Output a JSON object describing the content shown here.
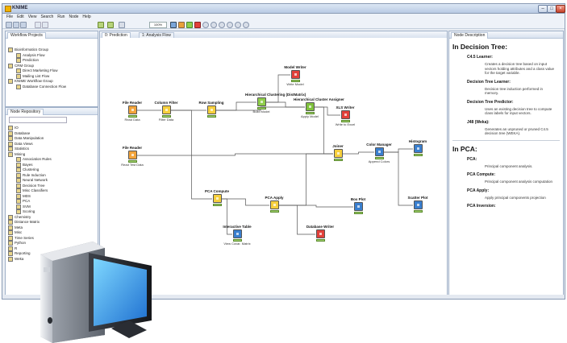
{
  "window": {
    "title": "KNIME"
  },
  "menu": [
    "File",
    "Edit",
    "View",
    "Search",
    "Run",
    "Node",
    "Help"
  ],
  "toolbar": {
    "zoom": "100%"
  },
  "projects": {
    "tab": "Workflow Projects",
    "items": [
      {
        "label": "Bioinformatics Group",
        "level": 0
      },
      {
        "label": "Analysis Flow",
        "level": 1
      },
      {
        "label": "Prediction",
        "level": 1
      },
      {
        "label": "CRM Group",
        "level": 0
      },
      {
        "label": "Direct Marketing Flow",
        "level": 1
      },
      {
        "label": "Mailing List Flow",
        "level": 1
      },
      {
        "label": "KNIME Workflow Group",
        "level": 0
      },
      {
        "label": "Database Connection Flow",
        "level": 1
      }
    ]
  },
  "repository": {
    "tab": "Node Repository",
    "items": [
      {
        "label": "IO",
        "level": 0
      },
      {
        "label": "Database",
        "level": 0
      },
      {
        "label": "Data Manipulation",
        "level": 0
      },
      {
        "label": "Data Views",
        "level": 0
      },
      {
        "label": "Statistics",
        "level": 0
      },
      {
        "label": "Mining",
        "level": 0
      },
      {
        "label": "Association Rules",
        "level": 1
      },
      {
        "label": "Bayes",
        "level": 1
      },
      {
        "label": "Clustering",
        "level": 1
      },
      {
        "label": "Rule Induction",
        "level": 1
      },
      {
        "label": "Neural Network",
        "level": 1
      },
      {
        "label": "Decision Tree",
        "level": 1
      },
      {
        "label": "Misc Classifiers",
        "level": 1
      },
      {
        "label": "MDS",
        "level": 1
      },
      {
        "label": "PCA",
        "level": 1
      },
      {
        "label": "SVM",
        "level": 1
      },
      {
        "label": "Scoring",
        "level": 1
      },
      {
        "label": "Chemistry",
        "level": 0
      },
      {
        "label": "Distance Matrix",
        "level": 0
      },
      {
        "label": "Meta",
        "level": 0
      },
      {
        "label": "Misc",
        "level": 0
      },
      {
        "label": "Time Series",
        "level": 0
      },
      {
        "label": "Python",
        "level": 0
      },
      {
        "label": "R",
        "level": 0
      },
      {
        "label": "Reporting",
        "level": 0
      },
      {
        "label": "Weka",
        "level": 0
      }
    ]
  },
  "editor": {
    "tabs": [
      "0: Prediction",
      "1: Analysis Flow"
    ],
    "nodes": [
      {
        "id": "file-reader-1",
        "title": "File Reader",
        "desc": "Read Data",
        "color": "#f2a33a",
        "status": "ok"
      },
      {
        "id": "column-filter",
        "title": "Column Filter",
        "desc": "Filter Data",
        "color": "#f6cf3c",
        "status": "ok"
      },
      {
        "id": "row-sampling",
        "title": "Row Sampling",
        "desc": "",
        "color": "#f6cf3c",
        "status": "ok"
      },
      {
        "id": "hier-clustering",
        "title": "Hierarchical Clustering (DistMatrix)",
        "desc": "Build Model",
        "color": "#8fcf4a",
        "status": "ok"
      },
      {
        "id": "model-writer",
        "title": "Model Writer",
        "desc": "Write Model",
        "color": "#e2403a",
        "status": "ok"
      },
      {
        "id": "hier-assigner",
        "title": "Hierarchical Cluster Assigner",
        "desc": "Apply Model",
        "color": "#7fc13c",
        "status": "ok"
      },
      {
        "id": "xls-writer",
        "title": "XLS Writer",
        "desc": "Write to Excel",
        "color": "#e2403a",
        "status": "ok"
      },
      {
        "id": "file-reader-2",
        "title": "File Reader",
        "desc": "Read Test Data",
        "color": "#f2a33a",
        "status": "ok"
      },
      {
        "id": "joiner",
        "title": "Joiner",
        "desc": "",
        "color": "#f6cf3c",
        "status": "ok"
      },
      {
        "id": "color-manager",
        "title": "Color Manager",
        "desc": "Append Colors",
        "color": "#3a7fcf",
        "status": "ok"
      },
      {
        "id": "histogram",
        "title": "Histogram",
        "desc": "",
        "color": "#3a7fcf",
        "status": "ok"
      },
      {
        "id": "pca-compute",
        "title": "PCA Compute",
        "desc": "",
        "color": "#f6cf3c",
        "status": "ok"
      },
      {
        "id": "pca-apply",
        "title": "PCA Apply",
        "desc": "",
        "color": "#f6cf3c",
        "status": "ok"
      },
      {
        "id": "box-plot",
        "title": "Box Plot",
        "desc": "",
        "color": "#3a7fcf",
        "status": "ok"
      },
      {
        "id": "scatter-plot",
        "title": "Scatter Plot",
        "desc": "",
        "color": "#3a7fcf",
        "status": "ok"
      },
      {
        "id": "interactive-table",
        "title": "Interactive Table",
        "desc": "View Covar. Matrix",
        "color": "#3a7fcf",
        "status": "ok"
      },
      {
        "id": "database-writer",
        "title": "Database Writer",
        "desc": "",
        "color": "#e2403a",
        "status": "ok"
      }
    ]
  },
  "description": {
    "tab": "Node Description",
    "sections": [
      {
        "title": "In Decision Tree:",
        "entries": [
          {
            "name": "C4.5 Learner:",
            "text": "Creates a decision tree based on input vectors holding attributes and a class value for the target variable."
          },
          {
            "name": "Decision Tree Learner:",
            "text": "Decision tree induction performed in memory."
          },
          {
            "name": "Decision Tree Predictor:",
            "text": "Uses an existing decision tree to compute class labels for input vectors."
          },
          {
            "name": "J48 (Weka):",
            "text": "Generates an unpruned or pruned C4.5 decision tree (WEKA)."
          }
        ]
      },
      {
        "title": "In PCA:",
        "entries": [
          {
            "name": "PCA:",
            "text": "Principal component analysis."
          },
          {
            "name": "PCA Compute:",
            "text": "Principal component analysis computation"
          },
          {
            "name": "PCA Apply:",
            "text": "Apply principal components projection"
          },
          {
            "name": "PCA Inversion:",
            "text": ""
          }
        ]
      }
    ]
  }
}
